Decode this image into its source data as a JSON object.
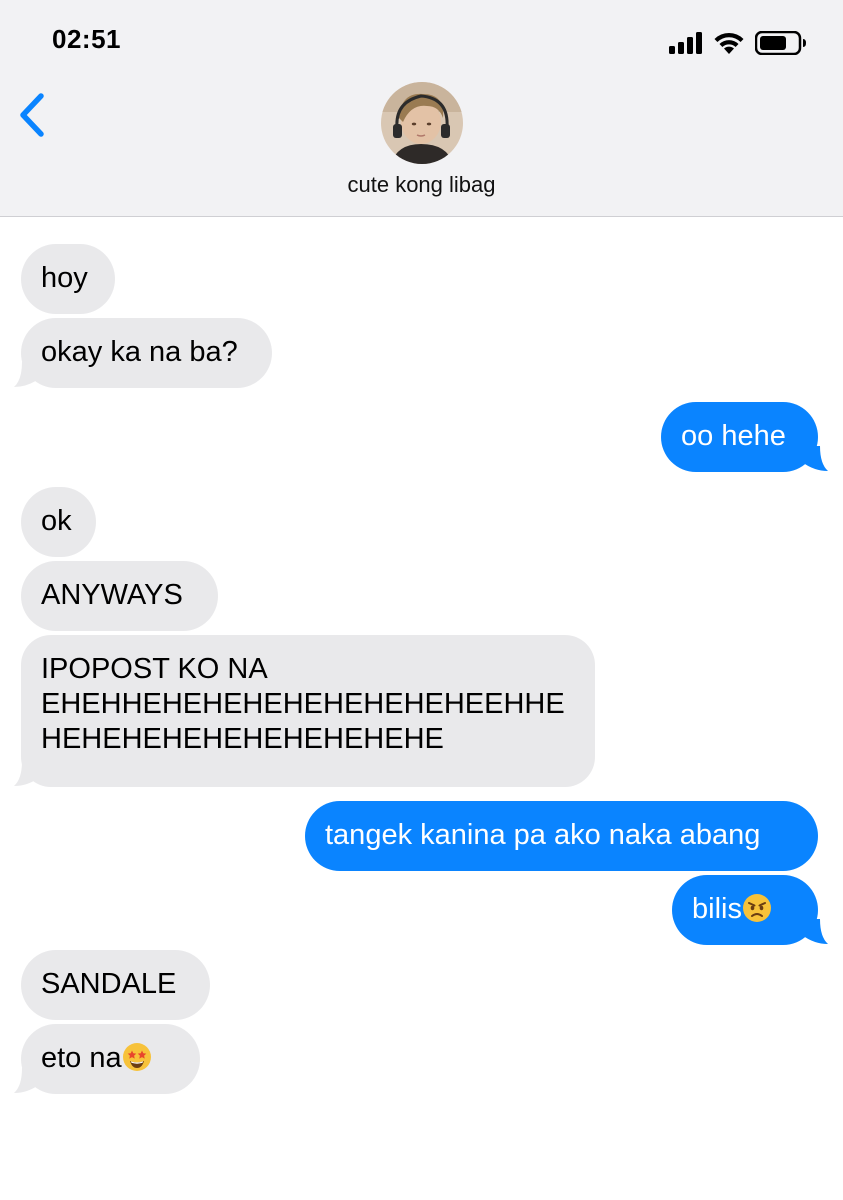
{
  "status_bar": {
    "time": "02:51",
    "signal_icon": "cellular-signal-icon",
    "wifi_icon": "wifi-icon",
    "battery_icon": "battery-icon"
  },
  "header": {
    "back_icon": "chevron-left-icon",
    "contact_name": "cute kong libag",
    "avatar": "contact-avatar"
  },
  "colors": {
    "sent_bubble": "#0a84ff",
    "received_bubble": "#e9e9eb",
    "header_bg": "#f2f2f4",
    "accent": "#0a84ff"
  },
  "messages": [
    {
      "direction": "received",
      "text": "hoy"
    },
    {
      "direction": "received",
      "text": "okay ka na ba?"
    },
    {
      "direction": "sent",
      "text": "oo hehe"
    },
    {
      "direction": "received",
      "text": "ok"
    },
    {
      "direction": "received",
      "text": "ANYWAYS"
    },
    {
      "direction": "received",
      "lines": [
        "IPOPOST KO NA",
        "EHEHHEHEHEHEHEHEHEHEHEEHHE",
        "HEHEHEHEHEHEHEHEHEHE"
      ]
    },
    {
      "direction": "sent",
      "text": "tangek kanina pa ako naka abang"
    },
    {
      "direction": "sent",
      "text": "bilis",
      "emoji": "angry-face-emoji"
    },
    {
      "direction": "received",
      "text": "SANDALE"
    },
    {
      "direction": "received",
      "text": "eto na",
      "emoji": "star-struck-emoji"
    }
  ]
}
